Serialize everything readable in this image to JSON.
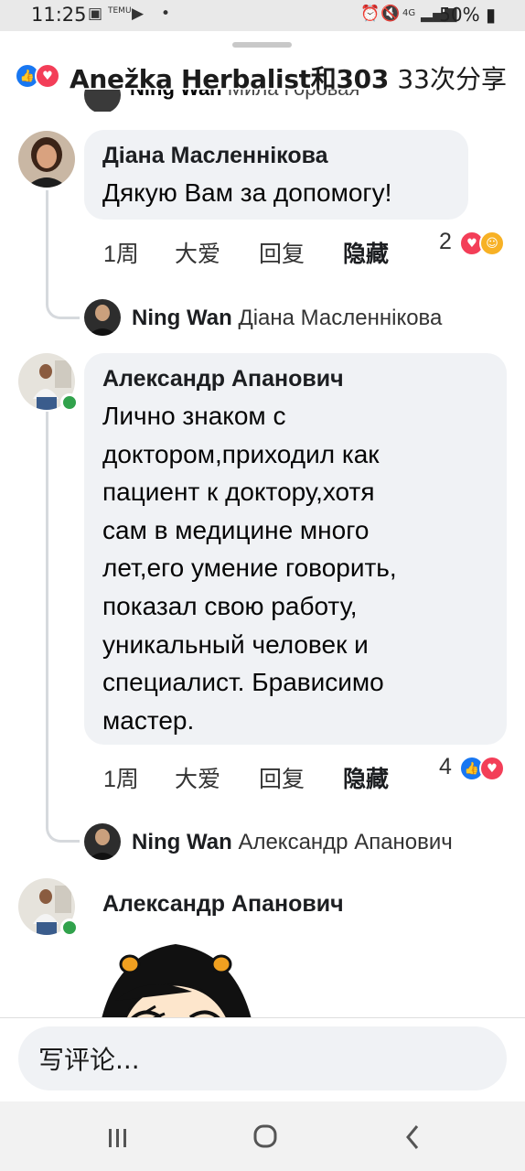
{
  "status_bar": {
    "time": "11:25",
    "app_label": "TEMU",
    "network": "4G",
    "battery": "50%"
  },
  "header": {
    "title": "Anežka Herbalist和303",
    "shares": "33次分享"
  },
  "partial_reply": {
    "author": "Ning Wan",
    "to": "Мила Горовая"
  },
  "comments": [
    {
      "author": "Діана Масленнікова",
      "text": "Дякую Вам за допомогу!",
      "time": "1周",
      "love_label": "大爱",
      "reply_label": "回复",
      "hide_label": "隐藏",
      "reactions_count": "2",
      "reactions": [
        "love",
        "care"
      ],
      "reply_preview": {
        "author": "Ning Wan",
        "to": "Діана Масленнікова"
      }
    },
    {
      "author": "Александр Апанович",
      "text": "Лично знаком с\nдоктором,приходил как\nпациент к доктору,хотя\nсам в медицине  много\nлет,его умение говорить,\nпоказал свою работу,\nуникальный человек и\nспециалист. Брависимо\nмастер.",
      "time": "1周",
      "love_label": "大爱",
      "reply_label": "回复",
      "hide_label": "隐藏",
      "reactions_count": "4",
      "reactions": [
        "like",
        "love"
      ],
      "reply_preview": {
        "author": "Ning Wan",
        "to": "Александр Апанович"
      }
    },
    {
      "author": "Александр Апанович",
      "sticker": "cartoon-girl-sticker"
    }
  ],
  "composer": {
    "placeholder": "写评论..."
  },
  "colors": {
    "like": "#1877f2",
    "love": "#f33e58",
    "care": "#f7b125",
    "bubble": "#f0f2f5",
    "online": "#31a24c"
  }
}
